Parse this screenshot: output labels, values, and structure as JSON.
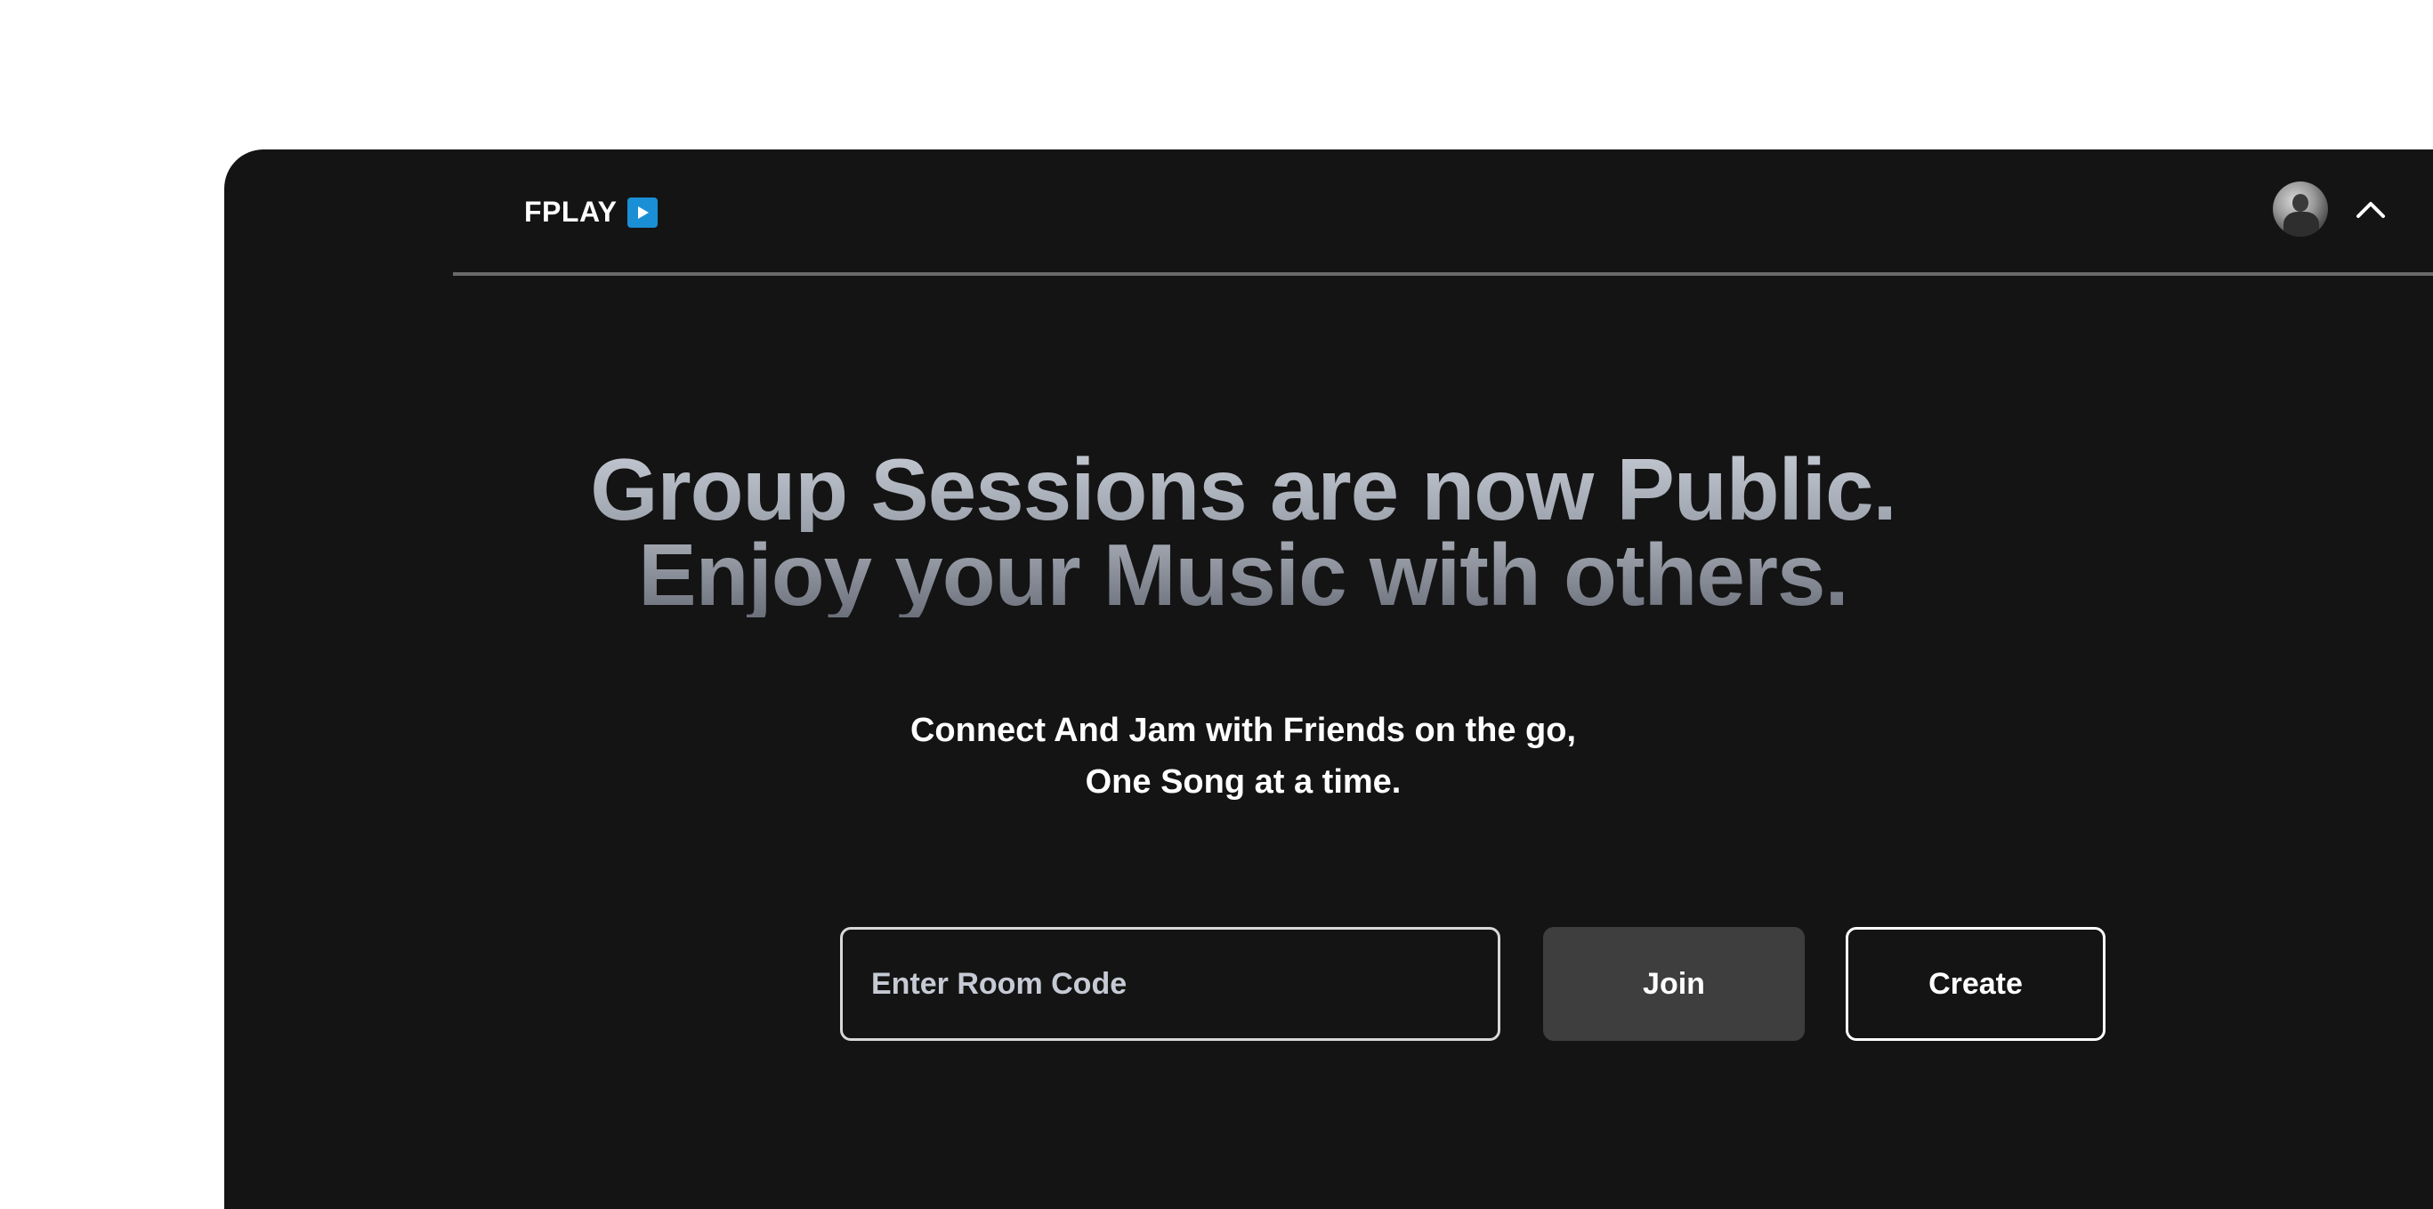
{
  "header": {
    "brand_name": "FPLAY",
    "brand_icon": "play-icon",
    "avatar_icon": "user-avatar",
    "toggle_icon": "chevron-up-icon"
  },
  "hero": {
    "title_line_1": "Group Sessions are now Public.",
    "title_line_2": "Enjoy your Music with others."
  },
  "subtitle": {
    "line_1": "Connect And Jam with Friends on the go,",
    "line_2": "One Song at a time."
  },
  "room": {
    "input_placeholder": "Enter Room Code",
    "input_value": "",
    "join_label": "Join",
    "create_label": "Create"
  },
  "colors": {
    "background": "#141414",
    "accent": "#1a8fd6",
    "join_button_bg": "#3e3e3e",
    "divider": "#6a6a6a"
  }
}
